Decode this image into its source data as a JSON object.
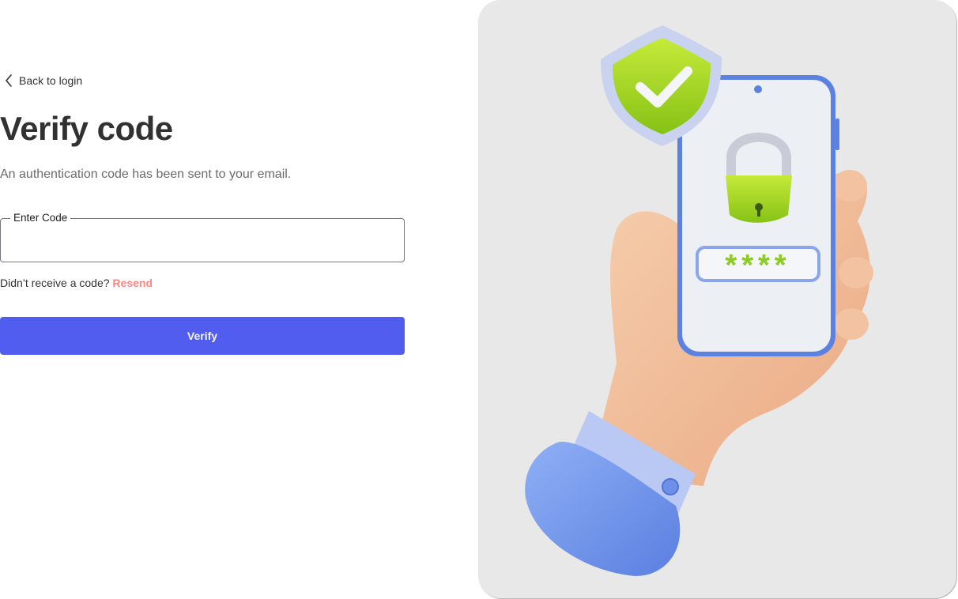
{
  "back_link": {
    "label": "Back to login",
    "icon": "chevron-left-icon"
  },
  "title": "Verify code",
  "subtitle": "An authentication code has been sent to your email.",
  "code_field": {
    "label": "Enter Code",
    "value": ""
  },
  "resend": {
    "prompt": "Didn’t receive a code?",
    "link_label": "Resend"
  },
  "verify_button": {
    "label": "Verify"
  },
  "illustration": {
    "code_mask": "****"
  },
  "colors": {
    "primary": "#515DEF",
    "resend": "#FF8682",
    "text": "#313131",
    "panel_bg": "#E8E8E8",
    "shield_green": "#9FD41A",
    "sleeve_blue": "#6C8FE8"
  }
}
